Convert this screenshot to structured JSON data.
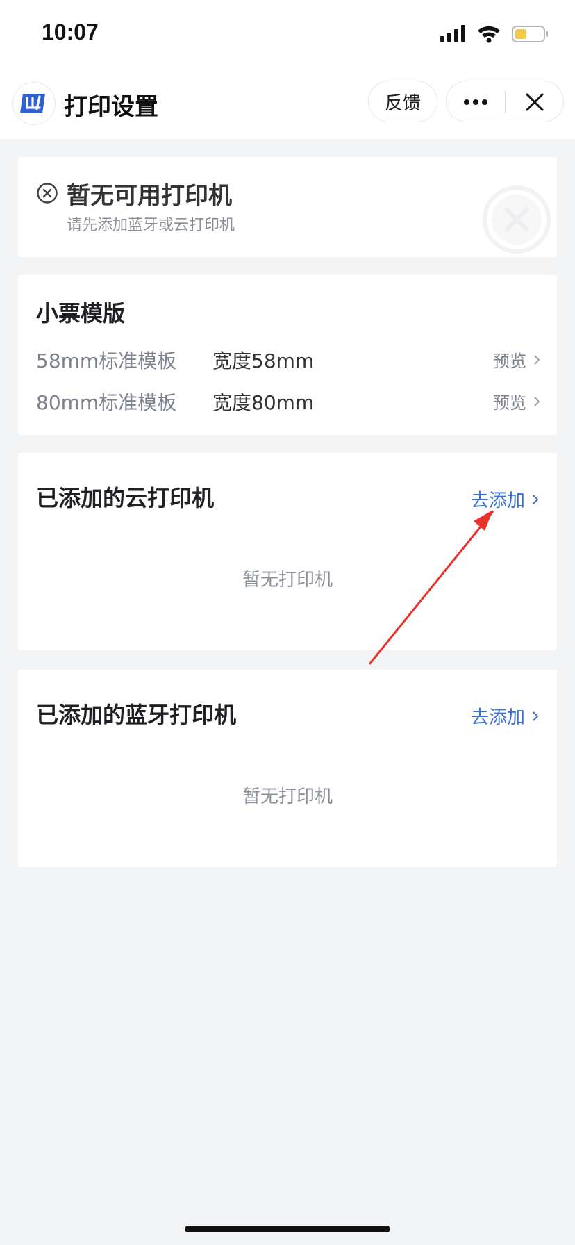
{
  "status_bar": {
    "time": "10:07"
  },
  "nav": {
    "title": "打印设置",
    "feedback": "反馈"
  },
  "printer_status": {
    "title": "暂无可用打印机",
    "subtitle": "请先添加蓝牙或云打印机"
  },
  "templates": {
    "title": "小票模版",
    "items": [
      {
        "name": "58mm标准模板",
        "width": "宽度58mm",
        "action": "预览"
      },
      {
        "name": "80mm标准模板",
        "width": "宽度80mm",
        "action": "预览"
      }
    ]
  },
  "cloud_printers": {
    "title": "已添加的云打印机",
    "add": "去添加",
    "empty": "暂无打印机"
  },
  "bluetooth_printers": {
    "title": "已添加的蓝牙打印机",
    "add": "去添加",
    "empty": "暂无打印机"
  },
  "colors": {
    "accent": "#3b6fd8",
    "arrow": "#e8312a",
    "background": "#f3f4f6"
  }
}
